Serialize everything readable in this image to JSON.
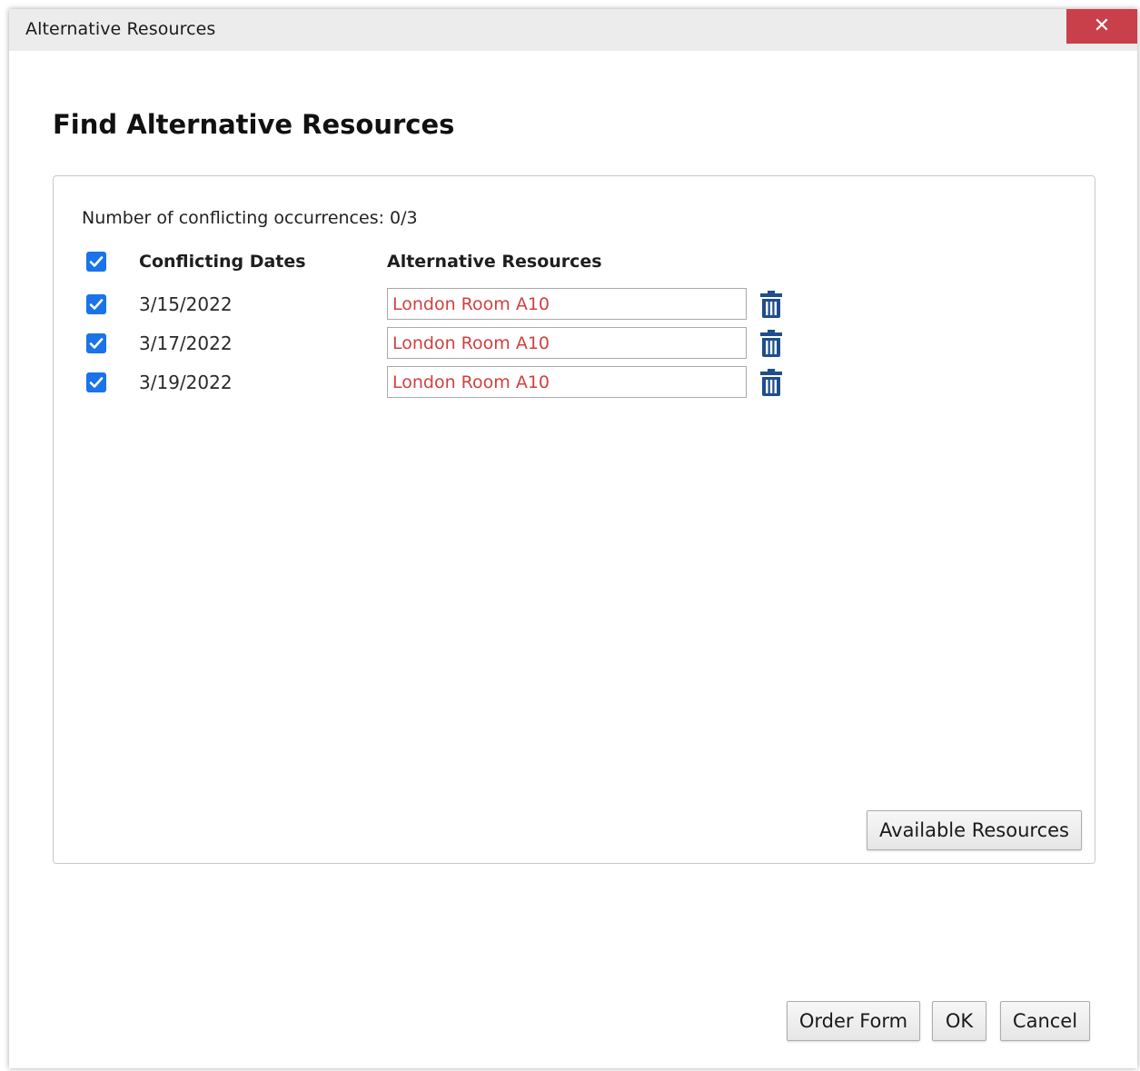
{
  "window": {
    "title": "Alternative Resources",
    "close_glyph": "✕"
  },
  "page": {
    "heading": "Find Alternative Resources"
  },
  "conflicts": {
    "count_label": "Number of conflicting occurrences: 0/3",
    "select_all_checked": true,
    "headers": {
      "dates": "Conflicting Dates",
      "resources": "Alternative Resources"
    },
    "rows": [
      {
        "checked": true,
        "date": "3/15/2022",
        "resource": "London Room A10"
      },
      {
        "checked": true,
        "date": "3/17/2022",
        "resource": "London Room A10"
      },
      {
        "checked": true,
        "date": "3/19/2022",
        "resource": "London Room A10"
      }
    ]
  },
  "buttons": {
    "available_resources": "Available Resources",
    "order_form": "Order Form",
    "ok": "OK",
    "cancel": "Cancel"
  },
  "colors": {
    "checkbox": "#1a73e8",
    "close_button": "#c9404a",
    "resource_text": "#d04040",
    "trash_icon": "#1f4e8c"
  },
  "icons": {
    "checkbox": "checkmark-icon",
    "delete": "trash-icon",
    "close": "close-icon"
  }
}
